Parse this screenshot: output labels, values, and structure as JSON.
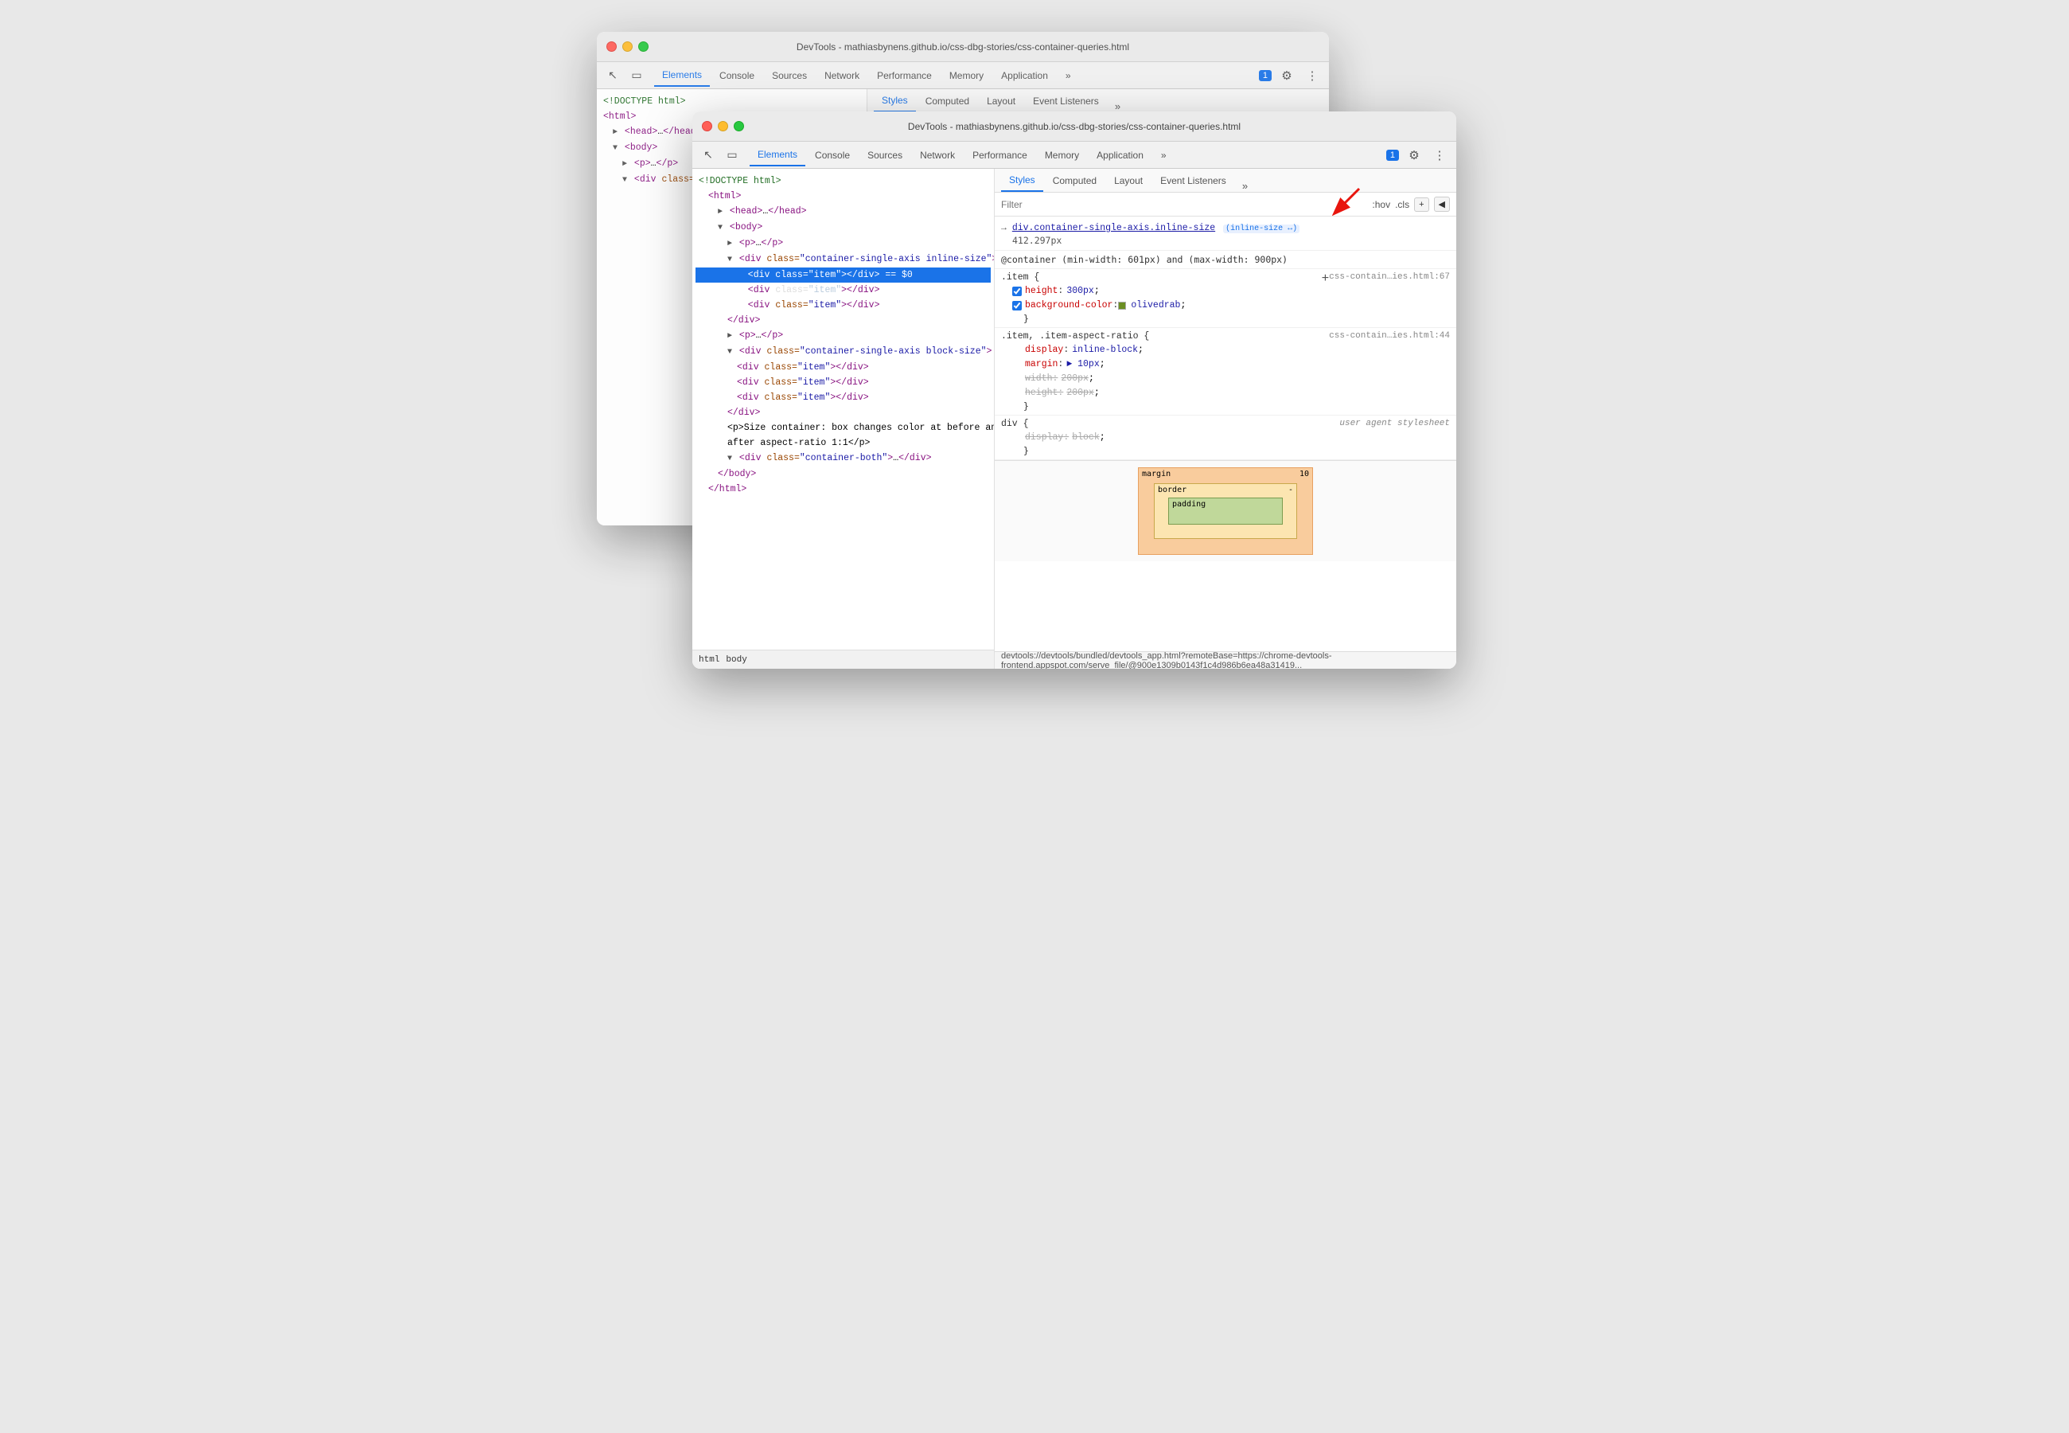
{
  "window_back": {
    "title": "DevTools - mathiasbynens.github.io/css-dbg-stories/css-container-queries.html",
    "tabs": [
      "Elements",
      "Console",
      "Sources",
      "Network",
      "Performance",
      "Memory",
      "Application"
    ],
    "active_tab": "Elements",
    "style_tabs": [
      "Styles",
      "Computed",
      "Layout",
      "Event Listeners"
    ],
    "active_style_tab": "Styles",
    "filter_placeholder": "Filter",
    "filter_hov": ":hov",
    "filter_cls": ".cls",
    "dom_lines": [
      {
        "indent": 0,
        "content": "<!DOCTYPE html>"
      },
      {
        "indent": 0,
        "content": "<html>"
      },
      {
        "indent": 1,
        "content": "<head>…</head>"
      },
      {
        "indent": 1,
        "content": "▼ <body>"
      },
      {
        "indent": 2,
        "content": "► <p>…</p>"
      },
      {
        "indent": 2,
        "content": "▼ <div class=\"container-single-axis inline-size\">"
      }
    ],
    "style_rules": [
      {
        "selector": "→ div.container-single-axis.i…size",
        "source": "",
        "props": []
      },
      {
        "text": "@container (min-width: 601px) and (max-width: 900px)"
      },
      {
        "selector": ".item {",
        "source": "css-contain…ies.html:67",
        "props": []
      }
    ]
  },
  "window_front": {
    "title": "DevTools - mathiasbynens.github.io/css-dbg-stories/css-container-queries.html",
    "tabs": [
      "Elements",
      "Console",
      "Sources",
      "Network",
      "Performance",
      "Memory",
      "Application"
    ],
    "active_tab": "Elements",
    "style_tabs": [
      "Styles",
      "Computed",
      "Layout",
      "Event Listeners"
    ],
    "active_style_tab": "Styles",
    "filter_placeholder": "Filter",
    "filter_hov": ":hov",
    "filter_cls": ".cls",
    "badge": "1",
    "dom_lines": [
      {
        "indent": 0,
        "text": "<!DOCTYPE html>"
      },
      {
        "indent": 1,
        "text": "<html>"
      },
      {
        "indent": 2,
        "text": "► <head>…</head>"
      },
      {
        "indent": 2,
        "text": "▼ <body>"
      },
      {
        "indent": 3,
        "text": "► <p>…</p>"
      },
      {
        "indent": 3,
        "text": "▼ <div class=\"container-single-axis inline-size\">"
      },
      {
        "indent": 4,
        "text": "<div class=\"item\"></div> == $0",
        "selected": true
      },
      {
        "indent": 4,
        "text": "<div class=\"item\"></div>"
      },
      {
        "indent": 4,
        "text": "<div class=\"item\"></div>"
      },
      {
        "indent": 3,
        "text": "</div>"
      },
      {
        "indent": 3,
        "text": "► <p>…</p>"
      },
      {
        "indent": 3,
        "text": "▼ <div class=\"container-single-axis block-size\">"
      },
      {
        "indent": 4,
        "text": "<div class=\"item\"></div>"
      },
      {
        "indent": 4,
        "text": "<div class=\"item\"></div>"
      },
      {
        "indent": 4,
        "text": "<div class=\"item\"></div>"
      },
      {
        "indent": 3,
        "text": "</div>"
      },
      {
        "indent": 3,
        "text": "<p>Size container: box changes color at before and"
      },
      {
        "indent": 3,
        "text": "after aspect-ratio 1:1</p>"
      },
      {
        "indent": 3,
        "text": "▼ <div class=\"container-both\">…</div>"
      },
      {
        "indent": 2,
        "text": "</body>"
      },
      {
        "indent": 1,
        "text": "</html>"
      }
    ],
    "style_rules": [
      {
        "id": "rule1",
        "selector": "→ div.container-single-axis.inline-size",
        "inline_size": "(inline-size ↔)",
        "value": "412.297px",
        "source": ""
      },
      {
        "id": "rule2",
        "container_query": "@container (min-width: 601px) and (max-width: 900px)"
      },
      {
        "id": "rule3",
        "selector": ".item {",
        "source": "css-contain…ies.html:67",
        "props": [
          {
            "name": "height",
            "value": "300px",
            "checked": true,
            "strikethrough": false
          },
          {
            "name": "background-color",
            "value": "olivedrab",
            "checked": true,
            "strikethrough": false,
            "color": "#6b8e23"
          }
        ]
      },
      {
        "id": "rule4",
        "selector": ".item, .item-aspect-ratio {",
        "source": "css-contain…ies.html:44",
        "props": [
          {
            "name": "display",
            "value": "inline-block",
            "checked": false,
            "strikethrough": false
          },
          {
            "name": "margin",
            "value": "► 10px",
            "checked": false,
            "strikethrough": false
          },
          {
            "name": "width",
            "value": "200px",
            "checked": false,
            "strikethrough": true
          },
          {
            "name": "height",
            "value": "200px",
            "checked": false,
            "strikethrough": true
          }
        ]
      },
      {
        "id": "rule5",
        "selector": "div {",
        "source": "user agent stylesheet",
        "props": [
          {
            "name": "display",
            "value": "block",
            "checked": false,
            "strikethrough": true
          }
        ]
      }
    ],
    "breadcrumbs": [
      "html",
      "body"
    ],
    "status_bar": "devtools://devtools/bundled/devtools_app.html?remoteBase=https://chrome-devtools-frontend.appspot.com/serve_file/@900e1309b0143f1c4d986b6ea48a31419..."
  },
  "icons": {
    "cursor": "↖",
    "device": "▭",
    "more": "»",
    "settings": "⚙",
    "menu": "⋮",
    "plus": "+",
    "scroll_back": "◀"
  }
}
